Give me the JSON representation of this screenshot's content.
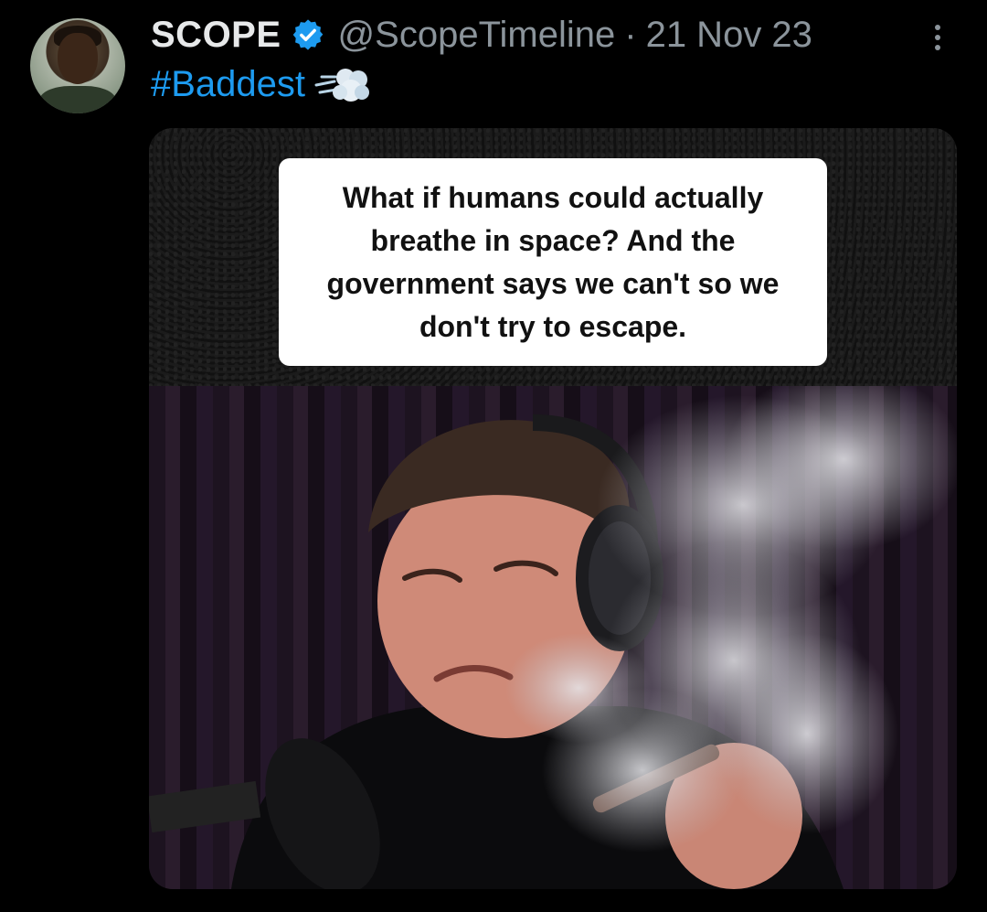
{
  "tweet": {
    "author_name": "SCOPE",
    "handle": "@ScopeTimeline",
    "separator": "·",
    "date": "21 Nov 23",
    "hashtag": "#Baddest"
  },
  "media": {
    "caption": "What if humans could actually breathe in space? And the government says we can't so we don't try to escape."
  },
  "icons": {
    "verified": "verified-badge-icon",
    "more": "more-vertical-icon",
    "emoji": "dashing-away-emoji-icon"
  },
  "colors": {
    "background": "#000000",
    "text_primary": "#e7e9ea",
    "text_secondary": "#8b949b",
    "accent": "#1d9bf0"
  }
}
